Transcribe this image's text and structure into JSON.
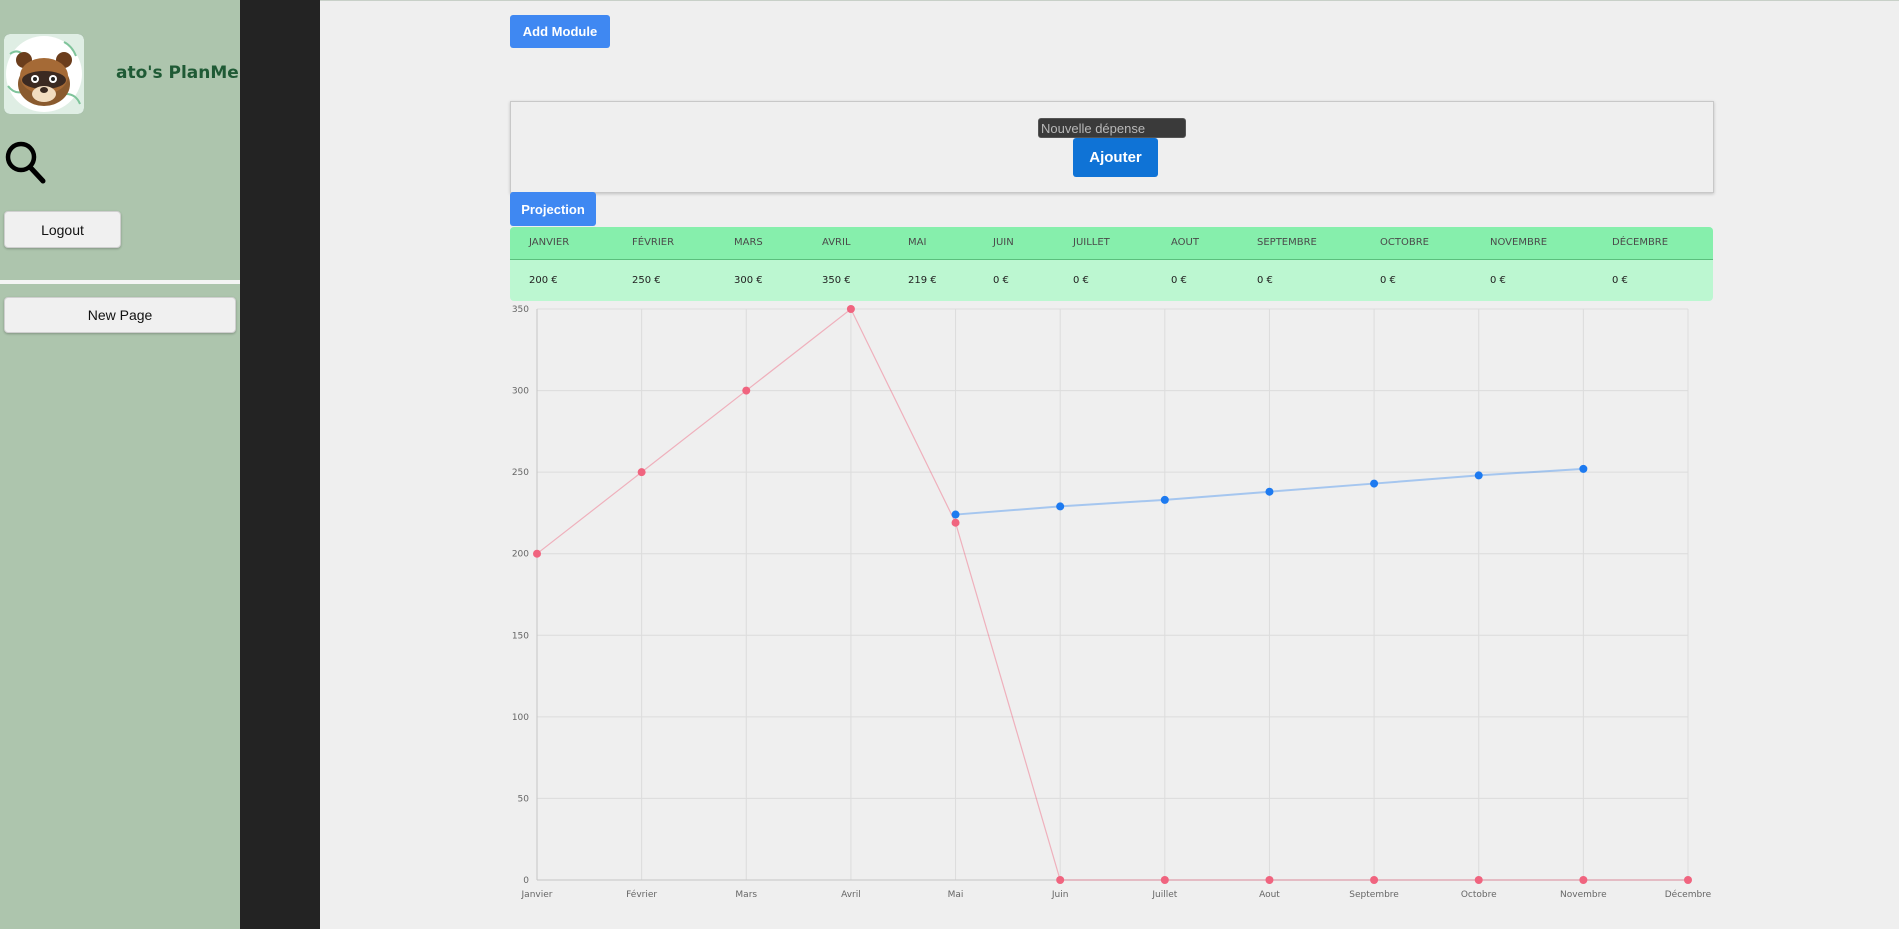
{
  "sidebar": {
    "app_title": "ato's PlanMe",
    "logout_label": "Logout",
    "new_page_label": "New Page"
  },
  "toolbar": {
    "add_module_label": "Add Module"
  },
  "expense_form": {
    "placeholder": "Nouvelle dépense",
    "add_label": "Ajouter"
  },
  "projection_label": "Projection",
  "months_table": {
    "headers": [
      "JANVIER",
      "FÉVRIER",
      "MARS",
      "AVRIL",
      "MAI",
      "JUIN",
      "JUILLET",
      "AOUT",
      "SEPTEMBRE",
      "OCTOBRE",
      "NOVEMBRE",
      "DÉCEMBRE"
    ],
    "values": [
      "200 €",
      "250 €",
      "300 €",
      "350 €",
      "219 €",
      "0 €",
      "0 €",
      "0 €",
      "0 €",
      "0 €",
      "0 €",
      "0 €"
    ]
  },
  "colors": {
    "actual_series": "#f0647f",
    "projection_series": "#1d7af0",
    "table_header": "#86efac",
    "table_body": "#bcf7d1"
  },
  "chart_data": {
    "type": "line",
    "categories": [
      "Janvier",
      "Février",
      "Mars",
      "Avril",
      "Mai",
      "Juin",
      "Juillet",
      "Aout",
      "Septembre",
      "Octobre",
      "Novembre",
      "Décembre"
    ],
    "series": [
      {
        "values": [
          200,
          250,
          300,
          350,
          219,
          0,
          0,
          0,
          0,
          0,
          0,
          0
        ]
      },
      {
        "values": [
          null,
          null,
          null,
          null,
          224,
          229,
          233,
          238,
          243,
          248,
          252,
          null
        ]
      }
    ],
    "yticks": [
      0,
      50,
      100,
      150,
      200,
      250,
      300,
      350
    ],
    "ylim": [
      0,
      350
    ],
    "grid": true,
    "legend": "none"
  }
}
